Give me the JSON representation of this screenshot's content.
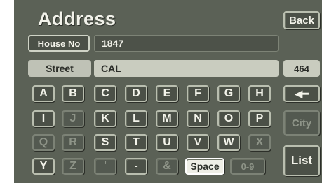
{
  "header": {
    "title": "Address",
    "back_label": "Back"
  },
  "house_no": {
    "label": "House No",
    "value": "1847"
  },
  "street": {
    "label": "Street",
    "value": "CAL_",
    "count": "464"
  },
  "keyboard": {
    "rows": [
      [
        {
          "label": "A",
          "enabled": true
        },
        {
          "label": "B",
          "enabled": true
        },
        {
          "label": "C",
          "enabled": true
        },
        {
          "label": "D",
          "enabled": true
        },
        {
          "label": "E",
          "enabled": true
        },
        {
          "label": "F",
          "enabled": true
        },
        {
          "label": "G",
          "enabled": true
        },
        {
          "label": "H",
          "enabled": true
        }
      ],
      [
        {
          "label": "I",
          "enabled": true
        },
        {
          "label": "J",
          "enabled": false
        },
        {
          "label": "K",
          "enabled": true
        },
        {
          "label": "L",
          "enabled": true
        },
        {
          "label": "M",
          "enabled": true
        },
        {
          "label": "N",
          "enabled": true
        },
        {
          "label": "O",
          "enabled": true
        },
        {
          "label": "P",
          "enabled": true
        }
      ],
      [
        {
          "label": "Q",
          "enabled": false
        },
        {
          "label": "R",
          "enabled": false
        },
        {
          "label": "S",
          "enabled": true
        },
        {
          "label": "T",
          "enabled": true
        },
        {
          "label": "U",
          "enabled": true
        },
        {
          "label": "V",
          "enabled": true
        },
        {
          "label": "W",
          "enabled": true
        },
        {
          "label": "X",
          "enabled": false
        }
      ],
      [
        {
          "label": "Y",
          "enabled": true
        },
        {
          "label": "Z",
          "enabled": false
        },
        {
          "label": "'",
          "enabled": false
        },
        {
          "label": "-",
          "enabled": true
        },
        {
          "label": "&",
          "enabled": false
        }
      ]
    ],
    "space_label": "Space",
    "numbers_label": "0-9"
  },
  "side": {
    "backspace_icon": "left-arrow-icon",
    "city_label": "City",
    "list_label": "List"
  },
  "colors": {
    "screen_bg": "#5b6156",
    "key_bg": "#4b5047",
    "key_border": "#b9beaf",
    "field_bg": "#4d5249"
  }
}
